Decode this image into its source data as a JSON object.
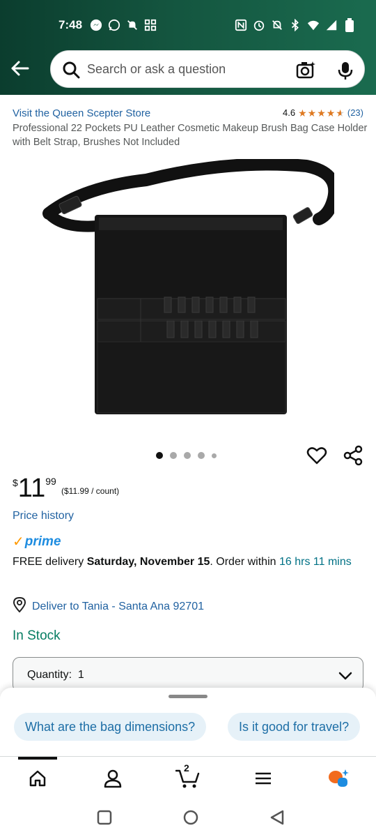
{
  "status": {
    "time": "7:48",
    "left_icons": [
      "messenger-icon",
      "whatsapp-icon",
      "notification-off-icon",
      "grid-icon"
    ],
    "right_icons": [
      "nfc-icon",
      "alarm-icon",
      "mute-icon",
      "bluetooth-icon",
      "wifi-icon",
      "signal-icon",
      "battery-icon"
    ]
  },
  "search": {
    "placeholder": "Search or ask a question"
  },
  "product": {
    "store_link": "Visit the Queen Scepter Store",
    "rating_value": "4.6",
    "rating_count": "(23)",
    "title": "Professional 22 Pockets PU Leather Cosmetic Makeup Brush Bag Case Holder with Belt Strap, Brushes Not Included",
    "image_count": 5,
    "active_image": 1
  },
  "price": {
    "currency": "$",
    "whole": "11",
    "fraction": "99",
    "unit_price": "($11.99 / count)",
    "history_link": "Price history"
  },
  "prime": {
    "label": "prime"
  },
  "delivery": {
    "prefix": "FREE delivery ",
    "date": "Saturday, November 15",
    "mid": ". Order within ",
    "countdown": "16 hrs 11 mins"
  },
  "location": {
    "text": "Deliver to Tania - Santa Ana 92701"
  },
  "stock": {
    "status": "In Stock"
  },
  "quantity": {
    "label": "Quantity:",
    "value": "1"
  },
  "suggestions": [
    "What are the bag dimensions?",
    "Is it good for travel?"
  ],
  "bottom_nav": {
    "cart_count": "2",
    "items": [
      "home-icon",
      "account-icon",
      "cart-icon",
      "menu-icon",
      "rufus-icon"
    ]
  },
  "colors": {
    "link": "#2162a1",
    "in_stock": "#067d62",
    "star": "#de7921",
    "prime_check": "#ff9900",
    "chip_bg": "#e6f1f8",
    "header_bg": "#14553f"
  }
}
